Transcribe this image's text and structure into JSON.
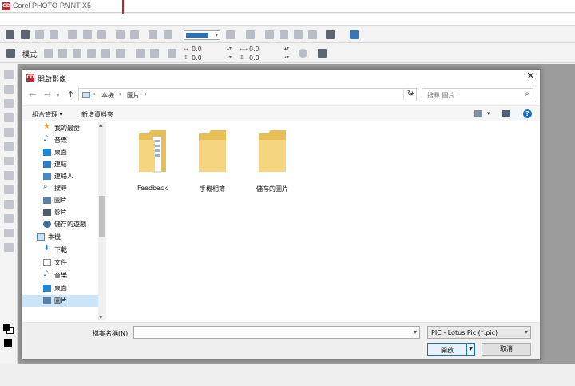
{
  "app": {
    "title": "Corel PHOTO-PAINT X5",
    "logo_text": "CD"
  },
  "toolbar2": {
    "mode_label": "模式",
    "x_value": "0.0",
    "y_value": "0.0",
    "w_value": "0.0",
    "h_value": "0.0"
  },
  "dialog": {
    "title": "開啟影像",
    "logo_text": "CD",
    "close_glyph": "✕",
    "nav": {
      "back": "←",
      "forward": "→",
      "up": "↑",
      "address": [
        "本機",
        "圖片"
      ],
      "refresh": "↻"
    },
    "search_placeholder": "搜尋 圖片",
    "commands": {
      "organize": "組合管理 ▾",
      "new_folder": "新增資料夾"
    },
    "nav_items": [
      {
        "label": "我的最愛",
        "icon": "star-icon"
      },
      {
        "label": "音樂",
        "icon": "music-icon"
      },
      {
        "label": "桌面",
        "icon": "desktop-icon"
      },
      {
        "label": "連結",
        "icon": "link-icon"
      },
      {
        "label": "連絡人",
        "icon": "contacts-icon"
      },
      {
        "label": "搜尋",
        "icon": "search-icon"
      },
      {
        "label": "圖片",
        "icon": "pictures-icon"
      },
      {
        "label": "影片",
        "icon": "video-icon"
      },
      {
        "label": "儲存的遊戲",
        "icon": "games-icon"
      },
      {
        "label": "本機",
        "icon": "computer-icon"
      },
      {
        "label": "下載",
        "icon": "download-icon"
      },
      {
        "label": "文件",
        "icon": "document-icon"
      },
      {
        "label": "音樂",
        "icon": "music-icon"
      },
      {
        "label": "桌面",
        "icon": "desktop-icon"
      },
      {
        "label": "圖片",
        "icon": "pictures-icon"
      }
    ],
    "folders": [
      {
        "label": "Feedback"
      },
      {
        "label": "手機相簿"
      },
      {
        "label": "儲存的圖片"
      }
    ],
    "filename_label": "檔案名稱(N):",
    "filename_value": "",
    "file_type": "PIC - Lotus Pic (*.pic)",
    "open_label": "開啟",
    "cancel_label": "取消"
  },
  "colors": {
    "accent": "#1a73c8",
    "brand": "#c0282d",
    "highlight": "#c8202a",
    "folder": "#f3d27a"
  }
}
